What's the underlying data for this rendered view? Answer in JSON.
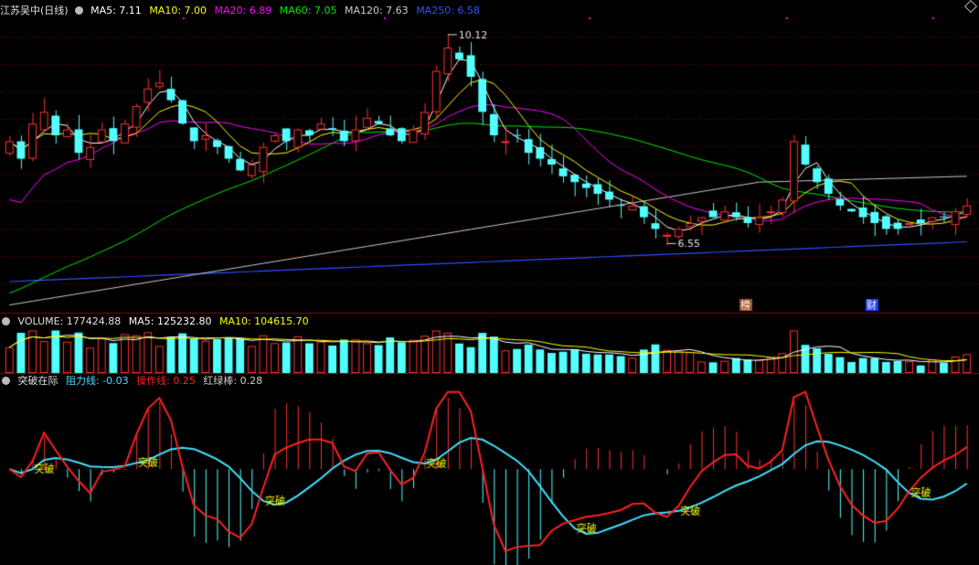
{
  "colors": {
    "up": "#ff3232",
    "down": "#54ffff",
    "ma5": "#ffffff",
    "ma10": "#ffff00",
    "ma20": "#ff00ff",
    "ma60": "#00e600",
    "ma120": "#cccccc",
    "ma250": "#3050ff",
    "resist": "#40e0ff",
    "operate": "#ff2020"
  },
  "panel_main": {
    "stock_name": "江苏吴中(日线)",
    "icon": "chevron-down-icon",
    "ma5": "MA5: 7.11",
    "ma10": "MA10: 7.00",
    "ma20": "MA20: 6.89",
    "ma60": "MA60: 7.05",
    "ma120": "MA120: 7.63",
    "ma250": "MA250: 6.58",
    "high_label": "10.12",
    "low_label": "6.55",
    "tag_list": "榜",
    "tag_finance": "财"
  },
  "panel_volume": {
    "volume": "VOLUME: 177424.88",
    "ma5": "MA5: 125232.80",
    "ma10": "MA10: 104615.70"
  },
  "panel_indicator": {
    "name": "突破在际",
    "resist": "阻力线: -0.03",
    "operate": "操作线: 0.25",
    "bar": "红绿棒: 0.28",
    "break_label": "突破"
  },
  "chart_data": {
    "type": "candlestick",
    "y_range_price": [
      5.4,
      10.4
    ],
    "high": 10.12,
    "low": 6.55,
    "closes": [
      8.3,
      8.0,
      8.6,
      8.8,
      8.4,
      8.5,
      8.1,
      8.2,
      8.5,
      8.3,
      8.6,
      8.9,
      9.2,
      9.3,
      9.0,
      8.6,
      8.3,
      8.4,
      8.2,
      8.0,
      7.8,
      7.9,
      8.2,
      8.4,
      8.3,
      8.5,
      8.4,
      8.6,
      8.5,
      8.3,
      8.5,
      8.7,
      8.6,
      8.4,
      8.3,
      8.5,
      8.8,
      9.5,
      9.9,
      9.7,
      9.4,
      8.8,
      8.4,
      8.3,
      8.4,
      8.1,
      8.0,
      7.9,
      7.7,
      7.6,
      7.5,
      7.4,
      7.3,
      7.2,
      7.2,
      7.0,
      6.8,
      6.7,
      6.8,
      6.9,
      7.0,
      7.0,
      7.1,
      7.0,
      6.9,
      7.0,
      7.1,
      7.3,
      8.3,
      7.9,
      7.6,
      7.4,
      7.2,
      7.1,
      7.0,
      6.9,
      6.8,
      6.8,
      6.9,
      6.9,
      7.0,
      7.0,
      7.1,
      7.2
    ],
    "volume_range": [
      0,
      320000
    ],
    "indicator_range": [
      -1.4,
      1.2
    ]
  }
}
